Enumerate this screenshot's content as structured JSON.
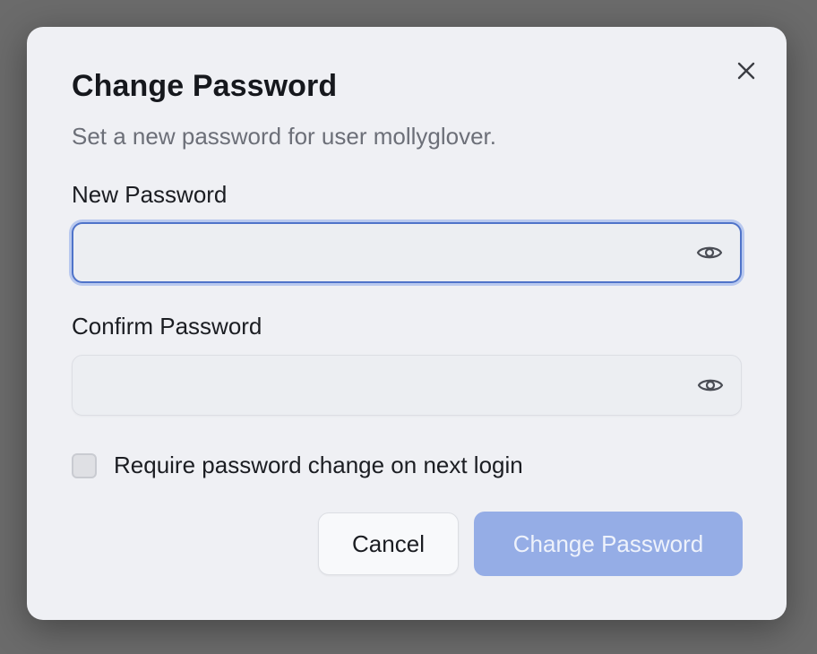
{
  "dialog": {
    "title": "Change Password",
    "subtitle": "Set a new password for user mollyglover.",
    "close_icon": "close-icon"
  },
  "fields": {
    "new_password": {
      "label": "New Password",
      "value": "",
      "placeholder": "",
      "toggle_icon": "eye-icon",
      "focused": true
    },
    "confirm_password": {
      "label": "Confirm Password",
      "value": "",
      "placeholder": "",
      "toggle_icon": "eye-icon"
    }
  },
  "require_change": {
    "label": "Require password change on next login",
    "checked": false
  },
  "actions": {
    "cancel_label": "Cancel",
    "submit_label": "Change Password",
    "submit_disabled": true
  },
  "colors": {
    "accent": "#4f73c9",
    "primary_disabled": "#95ade6",
    "backdrop": "#6b6b6b",
    "dialog_bg": "#eff0f4"
  }
}
